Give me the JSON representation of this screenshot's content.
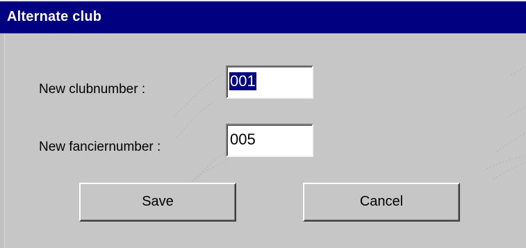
{
  "window": {
    "title": "Alternate club"
  },
  "form": {
    "club_label": "New clubnumber :",
    "club_value": "001",
    "fancier_label": "New fanciernumber :",
    "fancier_value": "005"
  },
  "buttons": {
    "save_label": "Save",
    "cancel_label": "Cancel"
  },
  "colors": {
    "titlebar": "#000080",
    "face": "#c6c6c6",
    "selection": "#000080"
  }
}
